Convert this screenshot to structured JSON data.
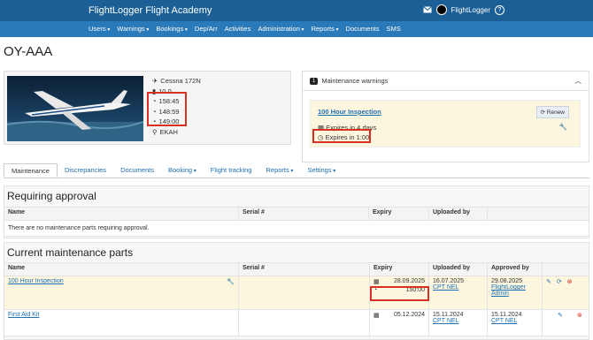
{
  "app": {
    "title": "FlightLogger Flight Academy",
    "user": "FlightLogger",
    "help": "?"
  },
  "nav": [
    {
      "label": "Users",
      "dropdown": true
    },
    {
      "label": "Warnings",
      "dropdown": true
    },
    {
      "label": "Bookings",
      "dropdown": true
    },
    {
      "label": "Dep/Arr",
      "dropdown": false
    },
    {
      "label": "Activities",
      "dropdown": false
    },
    {
      "label": "Administration",
      "dropdown": true
    },
    {
      "label": "Reports",
      "dropdown": true
    },
    {
      "label": "Documents",
      "dropdown": false
    },
    {
      "label": "SMS",
      "dropdown": false
    }
  ],
  "aircraft": {
    "registration": "OY-AAA",
    "model": "Cessna 172N",
    "fuel": "10.0",
    "timer1": "158:45",
    "timer2": "148:59",
    "timer3": "149:00",
    "base": "EKAH"
  },
  "warnings": {
    "title": "Maintenance warnings",
    "count": "1",
    "item_title": "100 Hour Inspection",
    "renew_label": "Renew",
    "expires_days": "Expires in 4 days",
    "expires_hours": "Expires in 1:00"
  },
  "tabs": [
    {
      "label": "Maintenance",
      "dropdown": false,
      "active": true
    },
    {
      "label": "Discrepancies",
      "dropdown": false
    },
    {
      "label": "Documents",
      "dropdown": false
    },
    {
      "label": "Booking",
      "dropdown": true
    },
    {
      "label": "Flight tracking",
      "dropdown": false
    },
    {
      "label": "Reports",
      "dropdown": true
    },
    {
      "label": "Settings",
      "dropdown": true
    }
  ],
  "requiring_approval": {
    "title": "Requiring approval",
    "headers": [
      "Name",
      "Serial #",
      "Expiry",
      "Uploaded by"
    ],
    "empty": "There are no maintenance parts requiring approval."
  },
  "current_parts": {
    "title": "Current maintenance parts",
    "headers": [
      "Name",
      "Serial #",
      "Expiry",
      "Uploaded by",
      "Approved by"
    ],
    "rows": [
      {
        "name": "100 Hour Inspection",
        "serial": "",
        "expiry_date": "28.09.2025",
        "expiry_hours": "150:00",
        "uploaded_date": "16.07.2025",
        "uploaded_by": "CPT NEL",
        "approved_date": "29.08.2025",
        "approved_by": "FlightLogger Admin"
      },
      {
        "name": "First Aid Kit",
        "serial": "",
        "expiry_date": "05.12.2024",
        "expiry_hours": "",
        "uploaded_date": "15.11.2024",
        "uploaded_by": "CPT NEL",
        "approved_date": "15.11.2024",
        "approved_by": "CPT NEL"
      }
    ]
  }
}
